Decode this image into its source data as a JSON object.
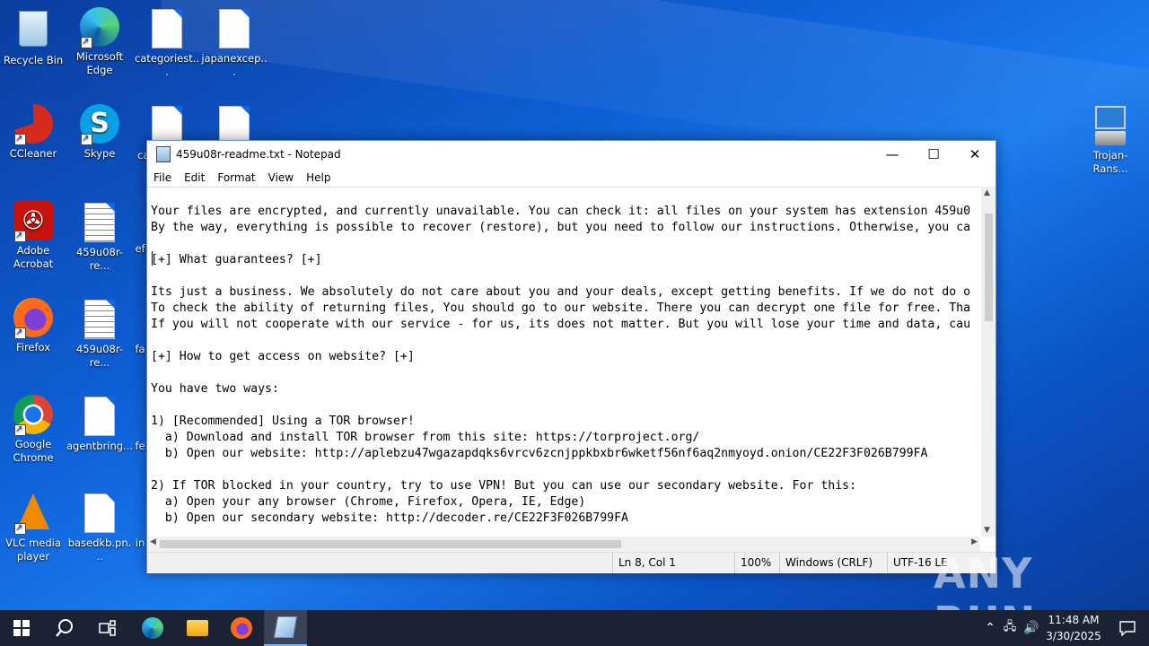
{
  "desktop": {
    "icons": [
      {
        "label": "Recycle Bin"
      },
      {
        "label": "Microsoft Edge"
      },
      {
        "label": "categoriest..."
      },
      {
        "label": "japanexcep..."
      },
      {
        "label": "CCleaner"
      },
      {
        "label": "Skype"
      },
      {
        "label": "ca"
      },
      {
        "label": "Adobe Acrobat"
      },
      {
        "label": "459u08r-re..."
      },
      {
        "label": "ef"
      },
      {
        "label": "Firefox"
      },
      {
        "label": "459u08r-re..."
      },
      {
        "label": "fa"
      },
      {
        "label": "Google Chrome"
      },
      {
        "label": "agentbring..."
      },
      {
        "label": "fe"
      },
      {
        "label": "VLC media player"
      },
      {
        "label": "basedkb.pn..."
      },
      {
        "label": "in"
      },
      {
        "label": "Trojan-Rans..."
      }
    ]
  },
  "notepad": {
    "title": "459u08r-readme.txt - Notepad",
    "menu": [
      "File",
      "Edit",
      "Format",
      "View",
      "Help"
    ],
    "lines": [
      "Your files are encrypted, and currently unavailable. You can check it: all files on your system has extension 459u0",
      "By the way, everything is possible to recover (restore), but you need to follow our instructions. Otherwise, you ca",
      "",
      "[+] What guarantees? [+]",
      "",
      "Its just a business. We absolutely do not care about you and your deals, except getting benefits. If we do not do o",
      "To check the ability of returning files, You should go to our website. There you can decrypt one file for free. Tha",
      "If you will not cooperate with our service - for us, its does not matter. But you will lose your time and data, cau",
      "",
      "[+] How to get access on website? [+]",
      "",
      "You have two ways:",
      "",
      "1) [Recommended] Using a TOR browser!",
      "  a) Download and install TOR browser from this site: https://torproject.org/",
      "  b) Open our website: http://aplebzu47wgazapdqks6vrcv6zcnjppkbxbr6wketf56nf6aq2nmyoyd.onion/CE22F3F026B799FA",
      "",
      "2) If TOR blocked in your country, try to use VPN! But you can use our secondary website. For this:",
      "  a) Open your any browser (Chrome, Firefox, Opera, IE, Edge)",
      "  b) Open our secondary website: http://decoder.re/CE22F3F026B799FA"
    ],
    "status": {
      "position": "Ln 8, Col 1",
      "zoom": "100%",
      "line_endings": "Windows (CRLF)",
      "encoding": "UTF-16 LE"
    }
  },
  "taskbar": {
    "time": "11:48 AM",
    "date": "3/30/2025"
  },
  "watermark": "ANY RUN"
}
